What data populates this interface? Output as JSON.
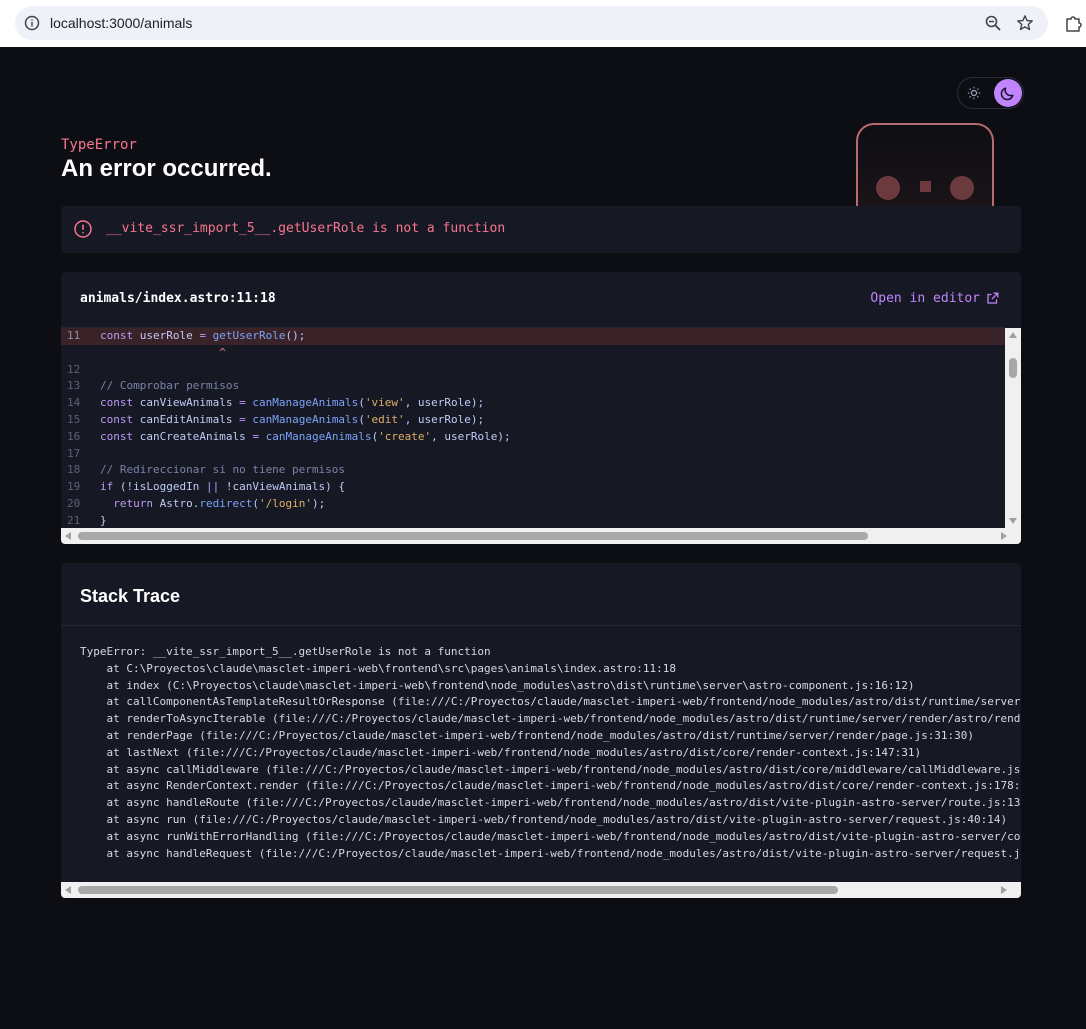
{
  "browser": {
    "url": "localhost:3000/animals"
  },
  "error": {
    "type": "TypeError",
    "title": "An error occurred.",
    "message": "__vite_ssr_import_5__.getUserRole is not a function"
  },
  "code": {
    "file": "animals/index.astro:11:18",
    "open_editor_label": "Open in editor",
    "lines": [
      {
        "n": "11",
        "highlight": true,
        "tokens": [
          [
            "kw",
            "const "
          ],
          [
            "var",
            "userRole "
          ],
          [
            "kw",
            "= "
          ],
          [
            "fn",
            "getUserRole"
          ],
          [
            "var",
            "();"
          ]
        ]
      },
      {
        "n": "",
        "highlight": false,
        "tokens": [
          [
            "caret",
            "                  ^"
          ]
        ]
      },
      {
        "n": "12",
        "highlight": false,
        "tokens": []
      },
      {
        "n": "13",
        "highlight": false,
        "tokens": [
          [
            "cm",
            "// Comprobar permisos"
          ]
        ]
      },
      {
        "n": "14",
        "highlight": false,
        "tokens": [
          [
            "kw",
            "const "
          ],
          [
            "var",
            "canViewAnimals "
          ],
          [
            "kw",
            "= "
          ],
          [
            "fn",
            "canManageAnimals"
          ],
          [
            "var",
            "("
          ],
          [
            "str",
            "'view'"
          ],
          [
            "var",
            ", userRole);"
          ]
        ]
      },
      {
        "n": "15",
        "highlight": false,
        "tokens": [
          [
            "kw",
            "const "
          ],
          [
            "var",
            "canEditAnimals "
          ],
          [
            "kw",
            "= "
          ],
          [
            "fn",
            "canManageAnimals"
          ],
          [
            "var",
            "("
          ],
          [
            "str",
            "'edit'"
          ],
          [
            "var",
            ", userRole);"
          ]
        ]
      },
      {
        "n": "16",
        "highlight": false,
        "tokens": [
          [
            "kw",
            "const "
          ],
          [
            "var",
            "canCreateAnimals "
          ],
          [
            "kw",
            "= "
          ],
          [
            "fn",
            "canManageAnimals"
          ],
          [
            "var",
            "("
          ],
          [
            "str",
            "'create'"
          ],
          [
            "var",
            ", userRole);"
          ]
        ]
      },
      {
        "n": "17",
        "highlight": false,
        "tokens": []
      },
      {
        "n": "18",
        "highlight": false,
        "tokens": [
          [
            "cm",
            "// Redireccionar si no tiene permisos"
          ]
        ]
      },
      {
        "n": "19",
        "highlight": false,
        "tokens": [
          [
            "kw",
            "if "
          ],
          [
            "var",
            "(!isLoggedIn "
          ],
          [
            "kw",
            "|| "
          ],
          [
            "var",
            "!canViewAnimals) {"
          ]
        ]
      },
      {
        "n": "20",
        "highlight": false,
        "tokens": [
          [
            "kw",
            "  return "
          ],
          [
            "var",
            "Astro."
          ],
          [
            "fn",
            "redirect"
          ],
          [
            "var",
            "("
          ],
          [
            "str",
            "'/login'"
          ],
          [
            "var",
            ");"
          ]
        ]
      },
      {
        "n": "21",
        "highlight": false,
        "tokens": [
          [
            "var",
            "}"
          ]
        ]
      }
    ]
  },
  "stack": {
    "title": "Stack Trace",
    "lines": [
      "TypeError: __vite_ssr_import_5__.getUserRole is not a function",
      "    at C:\\Proyectos\\claude\\masclet-imperi-web\\frontend\\src\\pages\\animals\\index.astro:11:18",
      "    at index (C:\\Proyectos\\claude\\masclet-imperi-web\\frontend\\node_modules\\astro\\dist\\runtime\\server\\astro-component.js:16:12)",
      "    at callComponentAsTemplateResultOrResponse (file:///C:/Proyectos/claude/masclet-imperi-web/frontend/node_modules/astro/dist/runtime/server/r",
      "    at renderToAsyncIterable (file:///C:/Proyectos/claude/masclet-imperi-web/frontend/node_modules/astro/dist/runtime/server/render/astro/render",
      "    at renderPage (file:///C:/Proyectos/claude/masclet-imperi-web/frontend/node_modules/astro/dist/runtime/server/render/page.js:31:30)",
      "    at lastNext (file:///C:/Proyectos/claude/masclet-imperi-web/frontend/node_modules/astro/dist/core/render-context.js:147:31)",
      "    at async callMiddleware (file:///C:/Proyectos/claude/masclet-imperi-web/frontend/node_modules/astro/dist/core/middleware/callMiddleware.js:1",
      "    at async RenderContext.render (file:///C:/Proyectos/claude/masclet-imperi-web/frontend/node_modules/astro/dist/core/render-context.js:178:22",
      "    at async handleRoute (file:///C:/Proyectos/claude/masclet-imperi-web/frontend/node_modules/astro/dist/vite-plugin-astro-server/route.js:135",
      "    at async run (file:///C:/Proyectos/claude/masclet-imperi-web/frontend/node_modules/astro/dist/vite-plugin-astro-server/request.js:40:14)",
      "    at async runWithErrorHandling (file:///C:/Proyectos/claude/masclet-imperi-web/frontend/node_modules/astro/dist/vite-plugin-astro-server/cont",
      "    at async handleRequest (file:///C:/Proyectos/claude/masclet-imperi-web/frontend/node_modules/astro/dist/vite-plugin-astro-server/request.js:"
    ]
  },
  "icons": {
    "site_info": "info-icon",
    "zoom": "zoom-out-icon",
    "bookmark": "star-icon",
    "extensions": "puzzle-icon",
    "theme_light": "sun-icon",
    "theme_dark": "moon-icon",
    "error": "alert-circle-icon",
    "external": "external-link-icon"
  },
  "colors": {
    "background": "#0d0e14",
    "panel": "#161924",
    "error_red": "#f7768e",
    "accent_purple": "#c084fc"
  }
}
